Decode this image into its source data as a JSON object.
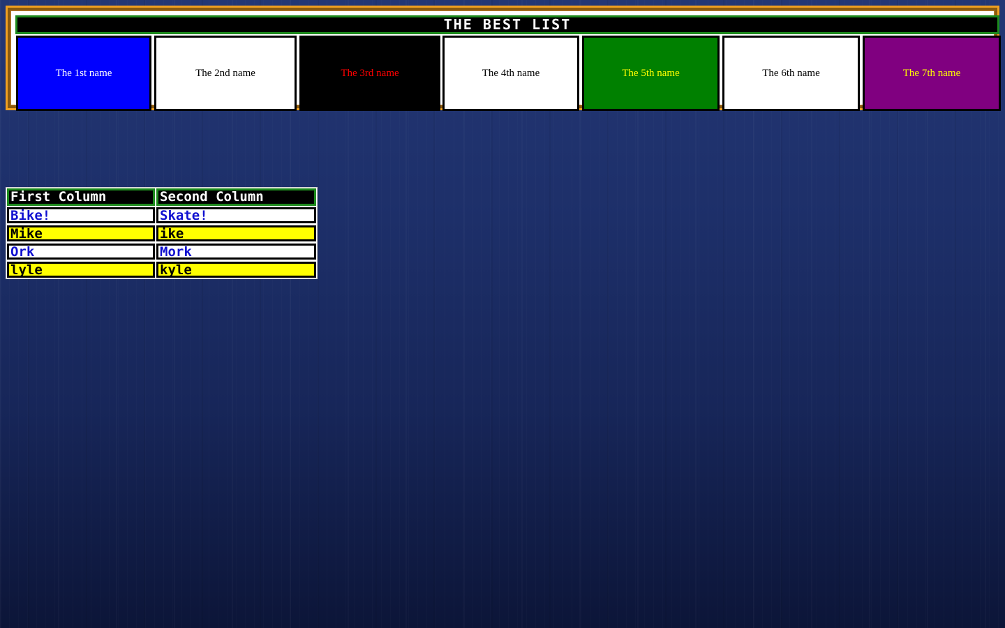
{
  "best_list": {
    "title": "THE BEST LIST",
    "items": [
      {
        "label": "The 1st name",
        "bg": "#0000ff",
        "color": "#ffffff"
      },
      {
        "label": "The 2nd name",
        "bg": "#ffffff",
        "color": "#000000"
      },
      {
        "label": "The 3rd name",
        "bg": "#000000",
        "color": "#ff0000"
      },
      {
        "label": "The 4th name",
        "bg": "#ffffff",
        "color": "#000000"
      },
      {
        "label": "The 5th name",
        "bg": "#008000",
        "color": "#ffff00"
      },
      {
        "label": "The 6th name",
        "bg": "#ffffff",
        "color": "#000000"
      },
      {
        "label": "The 7th name",
        "bg": "#800080",
        "color": "#ffff00"
      }
    ],
    "border_color": "#f0a020"
  },
  "columns_table": {
    "headers": [
      "First Column",
      "Second Column"
    ],
    "rows": [
      [
        "Bike!",
        "Skate!"
      ],
      [
        "Mike",
        "ike"
      ],
      [
        "Ork",
        "Mork"
      ],
      [
        "lyle",
        "kyle"
      ]
    ],
    "row_colors": [
      "#ffffff",
      "#ffff00",
      "#ffffff",
      "#ffff00"
    ]
  }
}
